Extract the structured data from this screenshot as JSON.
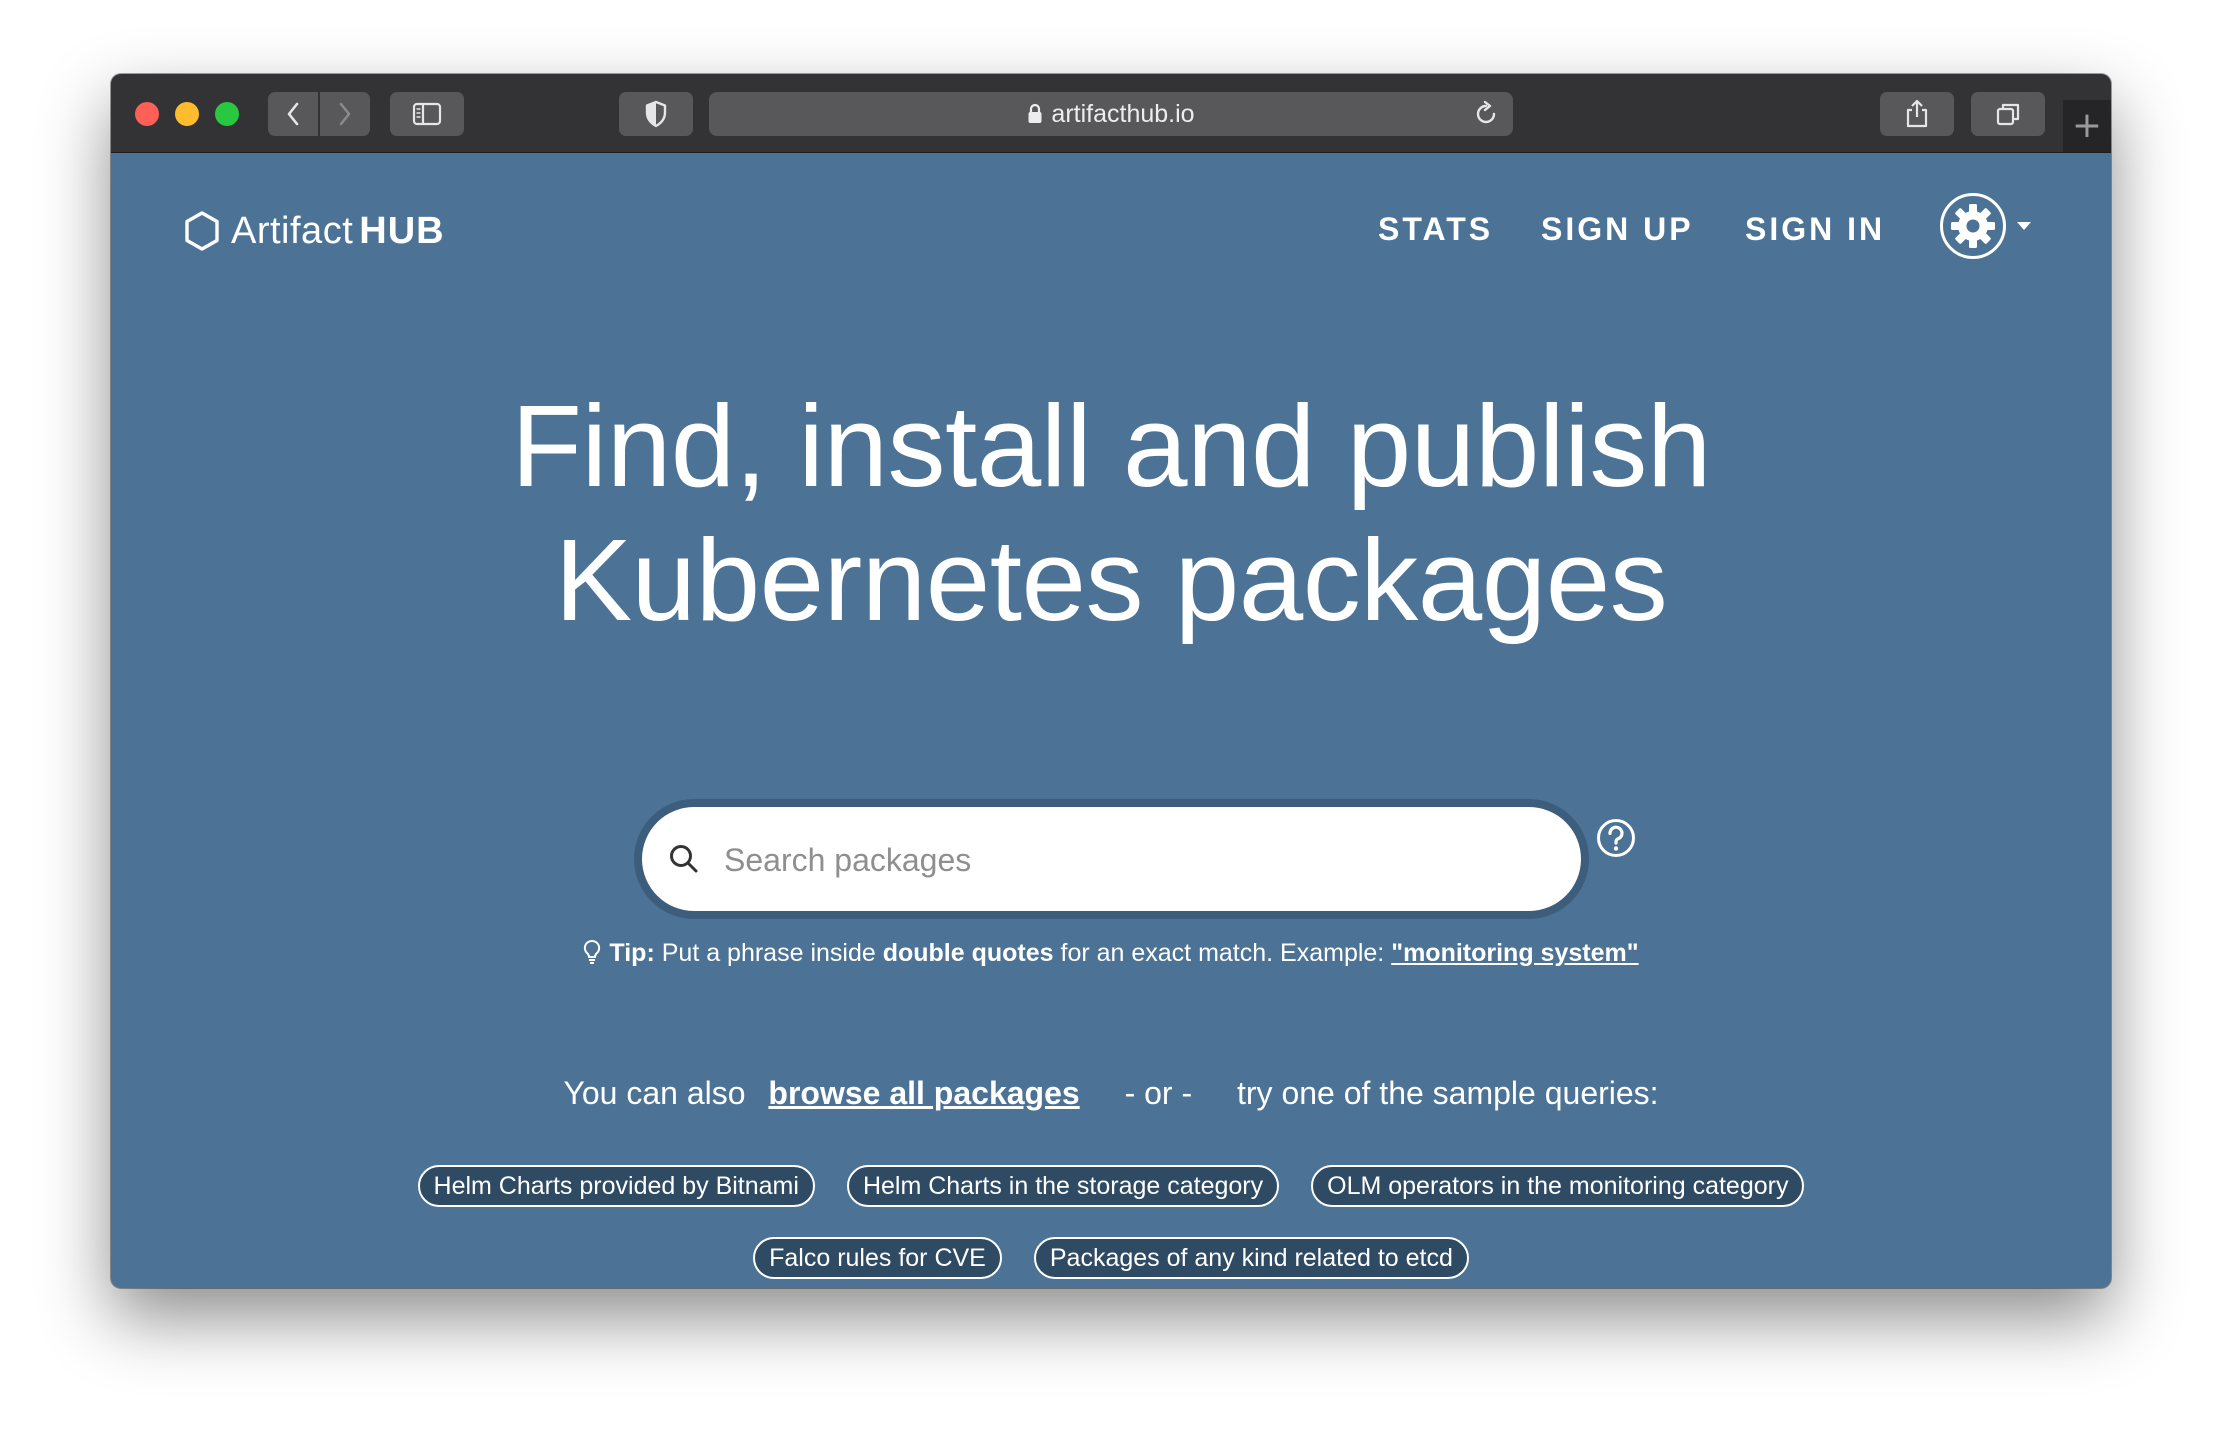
{
  "browser": {
    "url": "artifacthub.io",
    "icons": {
      "back": "chevron-left-icon",
      "forward": "chevron-right-icon",
      "sidebar": "sidebar-icon",
      "privacy": "shield-icon",
      "lock": "lock-icon",
      "reload": "reload-icon",
      "share": "share-icon",
      "tabs": "tabs-icon",
      "new_tab": "+"
    }
  },
  "header": {
    "logo_artifact": "Artifact",
    "logo_hub": "HUB",
    "nav": {
      "stats": "STATS",
      "signup": "SIGN UP",
      "signin": "SIGN IN"
    }
  },
  "hero": {
    "line1": "Find, install and publish",
    "line2": "Kubernetes packages"
  },
  "search": {
    "placeholder": "Search packages",
    "value": ""
  },
  "tip": {
    "label": "Tip:",
    "text1": "Put a phrase inside",
    "emphasis": "double quotes",
    "text2": "for an exact match. Example:",
    "example": "\"monitoring system\""
  },
  "browse": {
    "prefix": "You can also",
    "link": "browse all packages",
    "or": "- or -",
    "suffix": "try one of the sample queries:"
  },
  "sample_queries": [
    "Helm Charts provided by Bitnami",
    "Helm Charts in the storage category",
    "OLM operators in the monitoring category",
    "Falco rules for CVE",
    "Packages of any kind related to etcd"
  ],
  "colors": {
    "page_background": "#4c7396",
    "chip_background": "#2f4a63",
    "text": "#ffffff"
  }
}
